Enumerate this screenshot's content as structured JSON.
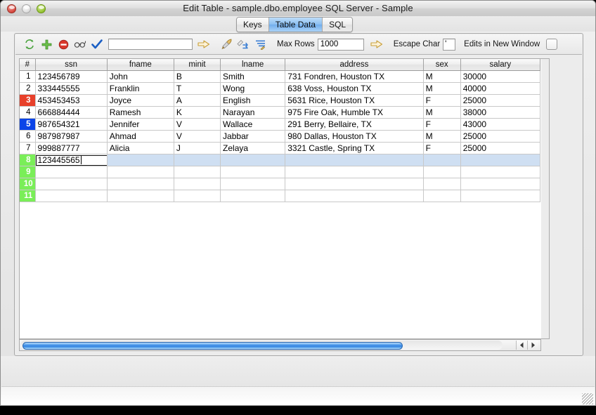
{
  "window": {
    "title": "Edit Table - sample.dbo.employee SQL Server - Sample",
    "traffic_lights": {
      "close": "close-button",
      "minimize": "minimize-button",
      "zoom": "zoom-button"
    }
  },
  "tabs": [
    {
      "label": "Keys",
      "active": false
    },
    {
      "label": "Table Data",
      "active": true
    },
    {
      "label": "SQL",
      "active": false
    }
  ],
  "toolbar": {
    "icons": [
      {
        "name": "refresh-icon",
        "glyph": "refresh"
      },
      {
        "name": "add-row-icon",
        "glyph": "plus"
      },
      {
        "name": "delete-row-icon",
        "glyph": "minus-circle"
      },
      {
        "name": "view-icon",
        "glyph": "glasses"
      },
      {
        "name": "commit-icon",
        "glyph": "check"
      }
    ],
    "filter_input": {
      "value": "",
      "placeholder": ""
    },
    "icons2": [
      {
        "name": "apply-filter-icon",
        "glyph": "arrow-right"
      },
      {
        "name": "execute-icon",
        "glyph": "rocket"
      },
      {
        "name": "edit-script-icon",
        "glyph": "pencil-arrows"
      },
      {
        "name": "sort-icon",
        "glyph": "sort-lines"
      }
    ],
    "max_rows_label": "Max Rows",
    "max_rows_value": "1000",
    "max_rows_apply_icon": "arrow-right-icon",
    "escape_char_label": "Escape Char",
    "escape_char_value": "'",
    "edits_new_window_label": "Edits in New Window",
    "edits_new_window_checked": false
  },
  "table": {
    "columns": [
      "#",
      "ssn",
      "fname",
      "minit",
      "lname",
      "address",
      "sex",
      "salary"
    ],
    "rows": [
      {
        "n": "1",
        "state": "normal",
        "ssn": "123456789",
        "fname": "John",
        "minit": "B",
        "lname": "Smith",
        "address": "731 Fondren, Houston TX",
        "sex": "M",
        "salary": "30000"
      },
      {
        "n": "2",
        "state": "normal",
        "ssn": "333445555",
        "fname": "Franklin",
        "minit": "T",
        "lname": "Wong",
        "address": "638 Voss, Houston TX",
        "sex": "M",
        "salary": "40000"
      },
      {
        "n": "3",
        "state": "red",
        "ssn": "453453453",
        "fname": "Joyce",
        "minit": "A",
        "lname": "English",
        "address": "5631 Rice, Houston TX",
        "sex": "F",
        "salary": "25000"
      },
      {
        "n": "4",
        "state": "normal",
        "ssn": "666884444",
        "fname": "Ramesh",
        "minit": "K",
        "lname": "Narayan",
        "address": "975 Fire Oak, Humble TX",
        "sex": "M",
        "salary": "38000"
      },
      {
        "n": "5",
        "state": "blue",
        "ssn": "987654321",
        "fname": "Jennifer",
        "minit": "V",
        "lname": "Wallace",
        "address": "291 Berry, Bellaire, TX",
        "sex": "F",
        "salary": "43000"
      },
      {
        "n": "6",
        "state": "normal",
        "ssn": "987987987",
        "fname": "Ahmad",
        "minit": "V",
        "lname": "Jabbar",
        "address": "980 Dallas, Houston TX",
        "sex": "M",
        "salary": "25000"
      },
      {
        "n": "7",
        "state": "normal",
        "ssn": "999887777",
        "fname": "Alicia",
        "minit": "J",
        "lname": "Zelaya",
        "address": "3321 Castle, Spring TX",
        "sex": "F",
        "salary": "25000"
      },
      {
        "n": "8",
        "state": "green",
        "editing": true,
        "ssn": "123445565",
        "fname": "",
        "minit": "",
        "lname": "",
        "address": "",
        "sex": "",
        "salary": ""
      },
      {
        "n": "9",
        "state": "green",
        "ssn": "",
        "fname": "",
        "minit": "",
        "lname": "",
        "address": "",
        "sex": "",
        "salary": ""
      },
      {
        "n": "10",
        "state": "green",
        "ssn": "",
        "fname": "",
        "minit": "",
        "lname": "",
        "address": "",
        "sex": "",
        "salary": ""
      },
      {
        "n": "11",
        "state": "green",
        "ssn": "",
        "fname": "",
        "minit": "",
        "lname": "",
        "address": "",
        "sex": "",
        "salary": ""
      }
    ]
  },
  "scrollbar": {
    "left_arrow": "scroll-left-icon",
    "right_arrow": "scroll-right-icon"
  },
  "colors": {
    "tab_active": "#8cc0f2",
    "row_state_red": "#e8402a",
    "row_state_blue": "#0b44e8",
    "row_state_green": "#7aee58",
    "new_row_fill": "#cfdff2",
    "scrollbar_thumb": "#2f7fe0"
  }
}
